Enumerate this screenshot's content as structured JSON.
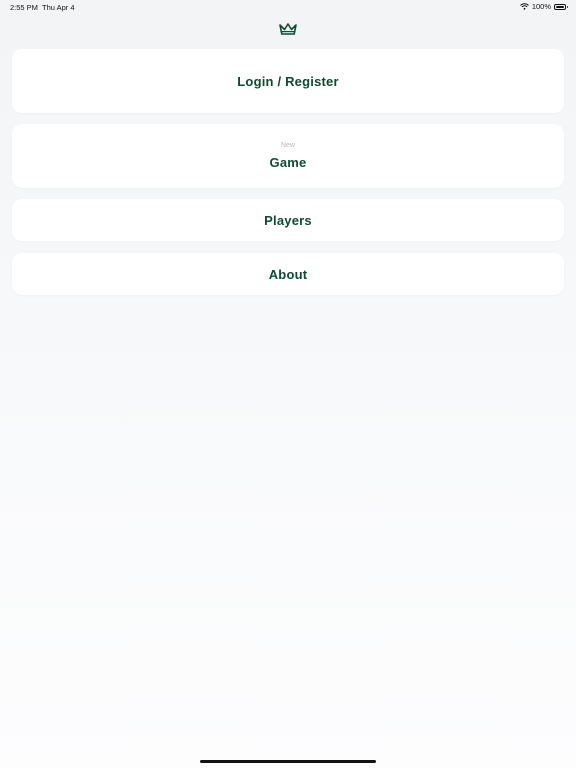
{
  "status_bar": {
    "time": "2:55 PM",
    "date": "Thu Apr 4",
    "battery_percent": "100%",
    "wifi_icon": "wifi-icon",
    "battery_icon": "battery-icon"
  },
  "header": {
    "logo_icon": "crown-icon"
  },
  "menu": {
    "login_label": "Login / Register",
    "game_sublabel": "New",
    "game_label": "Game",
    "players_label": "Players",
    "about_label": "About"
  },
  "colors": {
    "accent": "#0f4a32",
    "card": "#ffffff",
    "background": "#f2f4f6",
    "muted": "#b5b9bd"
  }
}
